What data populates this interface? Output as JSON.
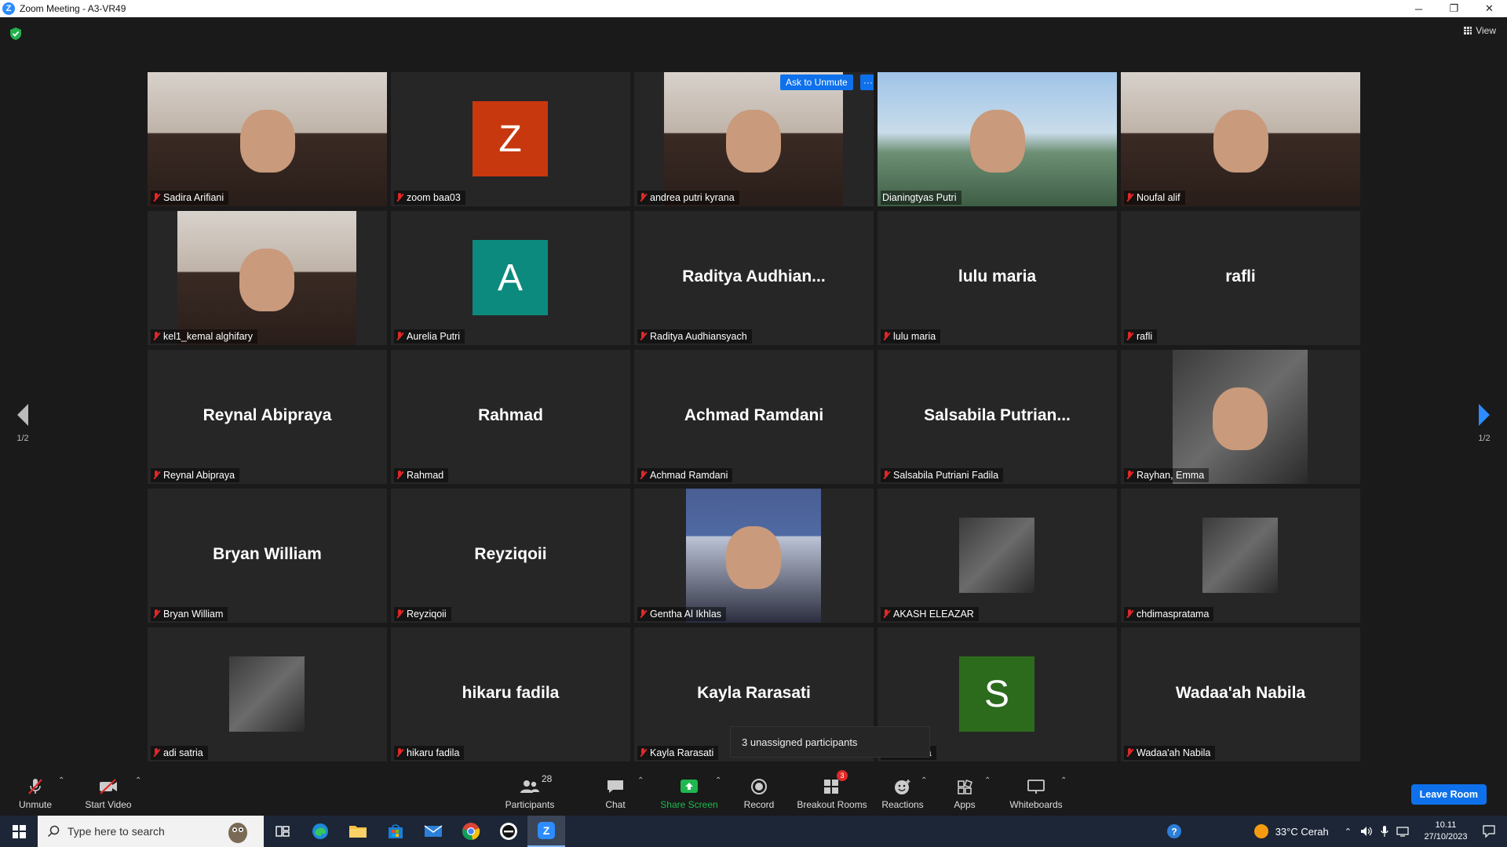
{
  "window": {
    "title": "Zoom Meeting - A3-VR49",
    "controls": [
      "─",
      "❐",
      "✕"
    ]
  },
  "top": {
    "view_label": "View"
  },
  "tiles": [
    {
      "label": "Sadira Arifiani",
      "kind": "video",
      "photo": "webcam-portrait"
    },
    {
      "label": "zoom baa03",
      "kind": "avatar",
      "letter": "Z",
      "color": "#c8380e"
    },
    {
      "label": "andrea putri kyrana",
      "kind": "video",
      "photo": "webcam-portrait",
      "ask_to_unmute": "Ask to Unmute",
      "more": "···"
    },
    {
      "label": "Dianingtyas Putri",
      "kind": "video",
      "photo": "active-speaker",
      "active": true,
      "mic_on": true
    },
    {
      "label": "Noufal alif",
      "kind": "video",
      "photo": "webcam-portrait"
    },
    {
      "label": "kel1_kemal alghifary",
      "kind": "video",
      "photo": "webcam-portrait"
    },
    {
      "label": "Aurelia Putri",
      "kind": "avatar",
      "letter": "A",
      "color": "#0c8a7d"
    },
    {
      "label": "Raditya Audhiansyach",
      "kind": "name",
      "display": "Raditya  Audhian..."
    },
    {
      "label": "lulu maria",
      "kind": "name",
      "display": "lulu maria"
    },
    {
      "label": "rafli",
      "kind": "name",
      "display": "rafli"
    },
    {
      "label": "Reynal Abipraya",
      "kind": "name",
      "display": "Reynal Abipraya"
    },
    {
      "label": "Rahmad",
      "kind": "name",
      "display": "Rahmad"
    },
    {
      "label": "Achmad Ramdani",
      "kind": "name",
      "display": "Achmad Ramdani"
    },
    {
      "label": "Salsabila Putriani Fadila",
      "kind": "name",
      "display": "Salsabila  Putrian..."
    },
    {
      "label": "Rayhan, Emma",
      "kind": "video",
      "photo": "profile-photo"
    },
    {
      "label": "Bryan William",
      "kind": "name",
      "display": "Bryan William"
    },
    {
      "label": "Reyziqoii",
      "kind": "name",
      "display": "Reyziqoii"
    },
    {
      "label": "Gentha Al Ikhlas",
      "kind": "video",
      "photo": "poster-photo"
    },
    {
      "label": "AKASH ELEAZAR",
      "kind": "photo-sq",
      "photo": "profile-photo"
    },
    {
      "label": "chdimaspratama",
      "kind": "photo-sq",
      "photo": "profile-photo"
    },
    {
      "label": "adi satria",
      "kind": "photo-sq",
      "photo": "profile-photo"
    },
    {
      "label": "hikaru fadila",
      "kind": "name",
      "display": "hikaru fadila"
    },
    {
      "label": "Kayla Rarasati",
      "kind": "name",
      "display": "Kayla Rarasati"
    },
    {
      "label": "salsabila",
      "kind": "avatar",
      "letter": "S",
      "color": "#2d6b1c"
    },
    {
      "label": "Wadaa'ah Nabila",
      "kind": "name",
      "display": "Wadaa'ah Nabila"
    }
  ],
  "pager": {
    "left": "1/2",
    "right": "1/2"
  },
  "popup": {
    "unassigned": "3 unassigned participants"
  },
  "toolbar": {
    "unmute": "Unmute",
    "start_video": "Start Video",
    "participants": "Participants",
    "participants_count": "28",
    "chat": "Chat",
    "share_screen": "Share Screen",
    "record": "Record",
    "breakout_rooms": "Breakout Rooms",
    "breakout_count": "3",
    "reactions": "Reactions",
    "apps": "Apps",
    "whiteboards": "Whiteboards",
    "leave": "Leave Room"
  },
  "taskbar": {
    "search_placeholder": "Type here to search",
    "weather": "33°C  Cerah",
    "time": "10.11",
    "date": "27/10/2023"
  },
  "colors": {
    "accent": "#0e71eb",
    "active_outline": "#e7e65b",
    "share_green": "#1fb74f",
    "muted_red": "#e02828"
  }
}
